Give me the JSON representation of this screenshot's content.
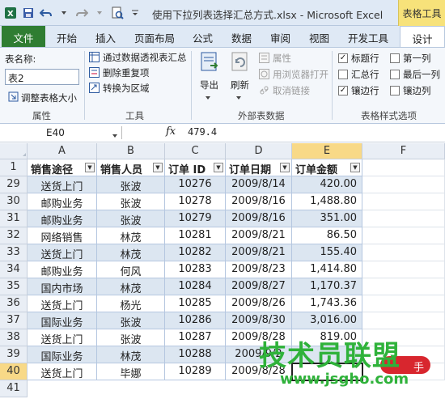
{
  "window": {
    "title": "使用下拉列表选择汇总方式.xlsx - Microsoft Excel",
    "context_tool": "表格工具"
  },
  "tabs": [
    "开始",
    "插入",
    "页面布局",
    "公式",
    "数据",
    "审阅",
    "视图",
    "开发工具"
  ],
  "tab_file": "文件",
  "tab_design": "设计",
  "ribbon": {
    "props": {
      "table_name_label": "表名称:",
      "table_name_value": "表2",
      "resize": "调整表格大小",
      "group": "属性"
    },
    "tools": {
      "pivot": "通过数据透视表汇总",
      "remove_dup": "删除重复项",
      "to_range": "转换为区域",
      "group": "工具"
    },
    "external": {
      "export": "导出",
      "refresh": "刷新",
      "properties": "属性",
      "open_browser": "用浏览器打开",
      "unlink": "取消链接",
      "group": "外部表数据"
    },
    "style_options": {
      "header_row": "标题行",
      "first_col": "第一列",
      "total_row": "汇总行",
      "last_col": "最后一列",
      "banded_rows": "镶边行",
      "banded_cols": "镶边列",
      "header_row_checked": "✓",
      "banded_rows_checked": "✓",
      "group": "表格样式选项"
    }
  },
  "formula_bar": {
    "cell_ref": "E40",
    "fx": "fx",
    "value": "479.4"
  },
  "columns": [
    "A",
    "B",
    "C",
    "D",
    "E",
    "F"
  ],
  "table": {
    "header_row_number": "1",
    "headers": [
      "销售途径",
      "销售人员",
      "订单 ID",
      "订单日期",
      "订单金额"
    ],
    "rows": [
      {
        "row": "29",
        "cells": [
          "送货上门",
          "张波",
          "10276",
          "2009/8/14",
          "420.00"
        ]
      },
      {
        "row": "30",
        "cells": [
          "邮购业务",
          "张波",
          "10278",
          "2009/8/16",
          "1,488.80"
        ]
      },
      {
        "row": "31",
        "cells": [
          "邮购业务",
          "张波",
          "10279",
          "2009/8/16",
          "351.00"
        ]
      },
      {
        "row": "32",
        "cells": [
          "网络销售",
          "林茂",
          "10281",
          "2009/8/21",
          "86.50"
        ]
      },
      {
        "row": "33",
        "cells": [
          "送货上门",
          "林茂",
          "10282",
          "2009/8/21",
          "155.40"
        ]
      },
      {
        "row": "34",
        "cells": [
          "邮购业务",
          "何风",
          "10283",
          "2009/8/23",
          "1,414.80"
        ]
      },
      {
        "row": "35",
        "cells": [
          "国内市场",
          "林茂",
          "10284",
          "2009/8/27",
          "1,170.37"
        ]
      },
      {
        "row": "36",
        "cells": [
          "送货上门",
          "杨光",
          "10285",
          "2009/8/26",
          "1,743.36"
        ]
      },
      {
        "row": "37",
        "cells": [
          "国际业务",
          "张波",
          "10286",
          "2009/8/30",
          "3,016.00"
        ]
      },
      {
        "row": "38",
        "cells": [
          "送货上门",
          "张波",
          "10287",
          "2009/8/28",
          "819.00"
        ]
      },
      {
        "row": "39",
        "cells": [
          "国际业务",
          "林茂",
          "10288",
          "2009/9/2",
          ""
        ]
      },
      {
        "row": "40",
        "cells": [
          "送货上门",
          "毕娜",
          "10289",
          "2009/8/28",
          ""
        ]
      }
    ],
    "next_row": "41"
  },
  "watermark": {
    "brand": "技术员联盟",
    "url": "www.jsgho.com",
    "badge": "手"
  },
  "colors": {
    "accent_green": "#2f7d32",
    "band_blue": "#dce6f1",
    "selected_header": "#f8d987",
    "context_yellow": "#f7e27a"
  }
}
